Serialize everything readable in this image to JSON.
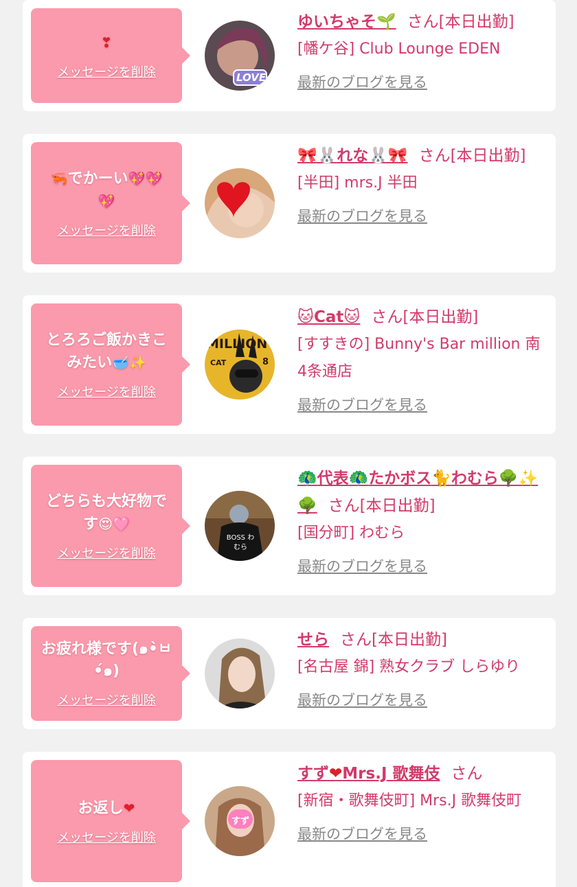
{
  "common": {
    "delete_label": "メッセージを削除",
    "blog_label": "最新のブログを見る",
    "status_full": "さん[本日出勤]",
    "status_short": "さん"
  },
  "cards": [
    {
      "message": "",
      "message_emoji": "❣",
      "name": "ゆいちゃそ",
      "name_emoji": "🌱",
      "shop": "[幡ケ谷] Club Lounge EDEN",
      "avatar_caption": "LOVE"
    },
    {
      "message_emoji_pre": "🦐",
      "message": "でかーい",
      "message_emoji": "💖💖💖",
      "name_emoji_pre": "🎀🐰",
      "name": "れな",
      "name_emoji": "🐰🎀",
      "shop": "[半田] mrs.J 半田"
    },
    {
      "message": "とろろご飯かきこみたい",
      "message_emoji": "🥣✨",
      "name_emoji_pre": "🐱",
      "name": "Cat",
      "name_emoji": "🐱",
      "shop": "[すすきの] Bunny's Bar million 南4条通店",
      "avatar_title": "MILLION",
      "avatar_sub": "CAT",
      "avatar_num": "8"
    },
    {
      "message": "どちらも大好物です",
      "message_emoji": "😍🩷",
      "name_emoji_pre": "🦚",
      "name": "代表",
      "name_part2_emoji": "🦚",
      "name_part2": "たかボス",
      "name_part3_emoji": "🐈",
      "name_part3": "わむら",
      "name_emoji": "🌳✨🌳",
      "shop": "[国分町] わむら",
      "avatar_text": "BOSS わむら"
    },
    {
      "message": "お疲れ様です(๑•̀ㅂ•́๑)",
      "name": "せら",
      "shop": "[名古屋 錦] 熟女クラブ しらゆり"
    },
    {
      "message": "お返し",
      "message_emoji": "❤",
      "name": "すず",
      "name_emoji": "❤",
      "name_part2": "Mrs.J 歌舞伎",
      "shop": "[新宿・歌舞伎町] Mrs.J 歌舞伎町",
      "avatar_badge": "すず"
    }
  ],
  "colors": {
    "page_bg": "#f1f1f1",
    "card_bg": "#ffffff",
    "bubble": "#fa9aac",
    "accent": "#d23a6b",
    "link_gray": "#888888"
  }
}
